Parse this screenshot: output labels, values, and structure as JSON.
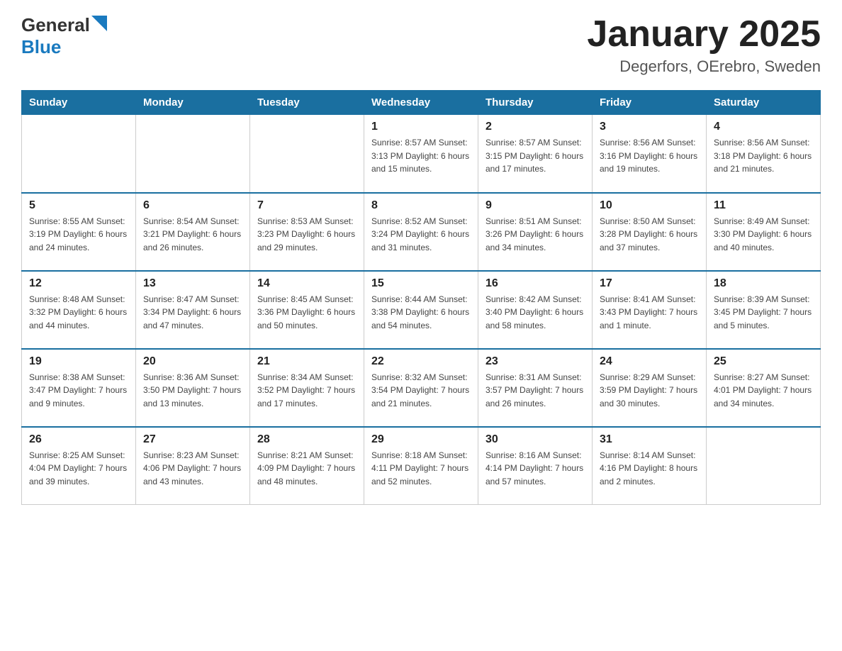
{
  "header": {
    "logo_general": "General",
    "logo_blue": "Blue",
    "title": "January 2025",
    "subtitle": "Degerfors, OErebro, Sweden"
  },
  "days_of_week": [
    "Sunday",
    "Monday",
    "Tuesday",
    "Wednesday",
    "Thursday",
    "Friday",
    "Saturday"
  ],
  "weeks": [
    [
      {
        "day": "",
        "info": ""
      },
      {
        "day": "",
        "info": ""
      },
      {
        "day": "",
        "info": ""
      },
      {
        "day": "1",
        "info": "Sunrise: 8:57 AM\nSunset: 3:13 PM\nDaylight: 6 hours\nand 15 minutes."
      },
      {
        "day": "2",
        "info": "Sunrise: 8:57 AM\nSunset: 3:15 PM\nDaylight: 6 hours\nand 17 minutes."
      },
      {
        "day": "3",
        "info": "Sunrise: 8:56 AM\nSunset: 3:16 PM\nDaylight: 6 hours\nand 19 minutes."
      },
      {
        "day": "4",
        "info": "Sunrise: 8:56 AM\nSunset: 3:18 PM\nDaylight: 6 hours\nand 21 minutes."
      }
    ],
    [
      {
        "day": "5",
        "info": "Sunrise: 8:55 AM\nSunset: 3:19 PM\nDaylight: 6 hours\nand 24 minutes."
      },
      {
        "day": "6",
        "info": "Sunrise: 8:54 AM\nSunset: 3:21 PM\nDaylight: 6 hours\nand 26 minutes."
      },
      {
        "day": "7",
        "info": "Sunrise: 8:53 AM\nSunset: 3:23 PM\nDaylight: 6 hours\nand 29 minutes."
      },
      {
        "day": "8",
        "info": "Sunrise: 8:52 AM\nSunset: 3:24 PM\nDaylight: 6 hours\nand 31 minutes."
      },
      {
        "day": "9",
        "info": "Sunrise: 8:51 AM\nSunset: 3:26 PM\nDaylight: 6 hours\nand 34 minutes."
      },
      {
        "day": "10",
        "info": "Sunrise: 8:50 AM\nSunset: 3:28 PM\nDaylight: 6 hours\nand 37 minutes."
      },
      {
        "day": "11",
        "info": "Sunrise: 8:49 AM\nSunset: 3:30 PM\nDaylight: 6 hours\nand 40 minutes."
      }
    ],
    [
      {
        "day": "12",
        "info": "Sunrise: 8:48 AM\nSunset: 3:32 PM\nDaylight: 6 hours\nand 44 minutes."
      },
      {
        "day": "13",
        "info": "Sunrise: 8:47 AM\nSunset: 3:34 PM\nDaylight: 6 hours\nand 47 minutes."
      },
      {
        "day": "14",
        "info": "Sunrise: 8:45 AM\nSunset: 3:36 PM\nDaylight: 6 hours\nand 50 minutes."
      },
      {
        "day": "15",
        "info": "Sunrise: 8:44 AM\nSunset: 3:38 PM\nDaylight: 6 hours\nand 54 minutes."
      },
      {
        "day": "16",
        "info": "Sunrise: 8:42 AM\nSunset: 3:40 PM\nDaylight: 6 hours\nand 58 minutes."
      },
      {
        "day": "17",
        "info": "Sunrise: 8:41 AM\nSunset: 3:43 PM\nDaylight: 7 hours\nand 1 minute."
      },
      {
        "day": "18",
        "info": "Sunrise: 8:39 AM\nSunset: 3:45 PM\nDaylight: 7 hours\nand 5 minutes."
      }
    ],
    [
      {
        "day": "19",
        "info": "Sunrise: 8:38 AM\nSunset: 3:47 PM\nDaylight: 7 hours\nand 9 minutes."
      },
      {
        "day": "20",
        "info": "Sunrise: 8:36 AM\nSunset: 3:50 PM\nDaylight: 7 hours\nand 13 minutes."
      },
      {
        "day": "21",
        "info": "Sunrise: 8:34 AM\nSunset: 3:52 PM\nDaylight: 7 hours\nand 17 minutes."
      },
      {
        "day": "22",
        "info": "Sunrise: 8:32 AM\nSunset: 3:54 PM\nDaylight: 7 hours\nand 21 minutes."
      },
      {
        "day": "23",
        "info": "Sunrise: 8:31 AM\nSunset: 3:57 PM\nDaylight: 7 hours\nand 26 minutes."
      },
      {
        "day": "24",
        "info": "Sunrise: 8:29 AM\nSunset: 3:59 PM\nDaylight: 7 hours\nand 30 minutes."
      },
      {
        "day": "25",
        "info": "Sunrise: 8:27 AM\nSunset: 4:01 PM\nDaylight: 7 hours\nand 34 minutes."
      }
    ],
    [
      {
        "day": "26",
        "info": "Sunrise: 8:25 AM\nSunset: 4:04 PM\nDaylight: 7 hours\nand 39 minutes."
      },
      {
        "day": "27",
        "info": "Sunrise: 8:23 AM\nSunset: 4:06 PM\nDaylight: 7 hours\nand 43 minutes."
      },
      {
        "day": "28",
        "info": "Sunrise: 8:21 AM\nSunset: 4:09 PM\nDaylight: 7 hours\nand 48 minutes."
      },
      {
        "day": "29",
        "info": "Sunrise: 8:18 AM\nSunset: 4:11 PM\nDaylight: 7 hours\nand 52 minutes."
      },
      {
        "day": "30",
        "info": "Sunrise: 8:16 AM\nSunset: 4:14 PM\nDaylight: 7 hours\nand 57 minutes."
      },
      {
        "day": "31",
        "info": "Sunrise: 8:14 AM\nSunset: 4:16 PM\nDaylight: 8 hours\nand 2 minutes."
      },
      {
        "day": "",
        "info": ""
      }
    ]
  ]
}
